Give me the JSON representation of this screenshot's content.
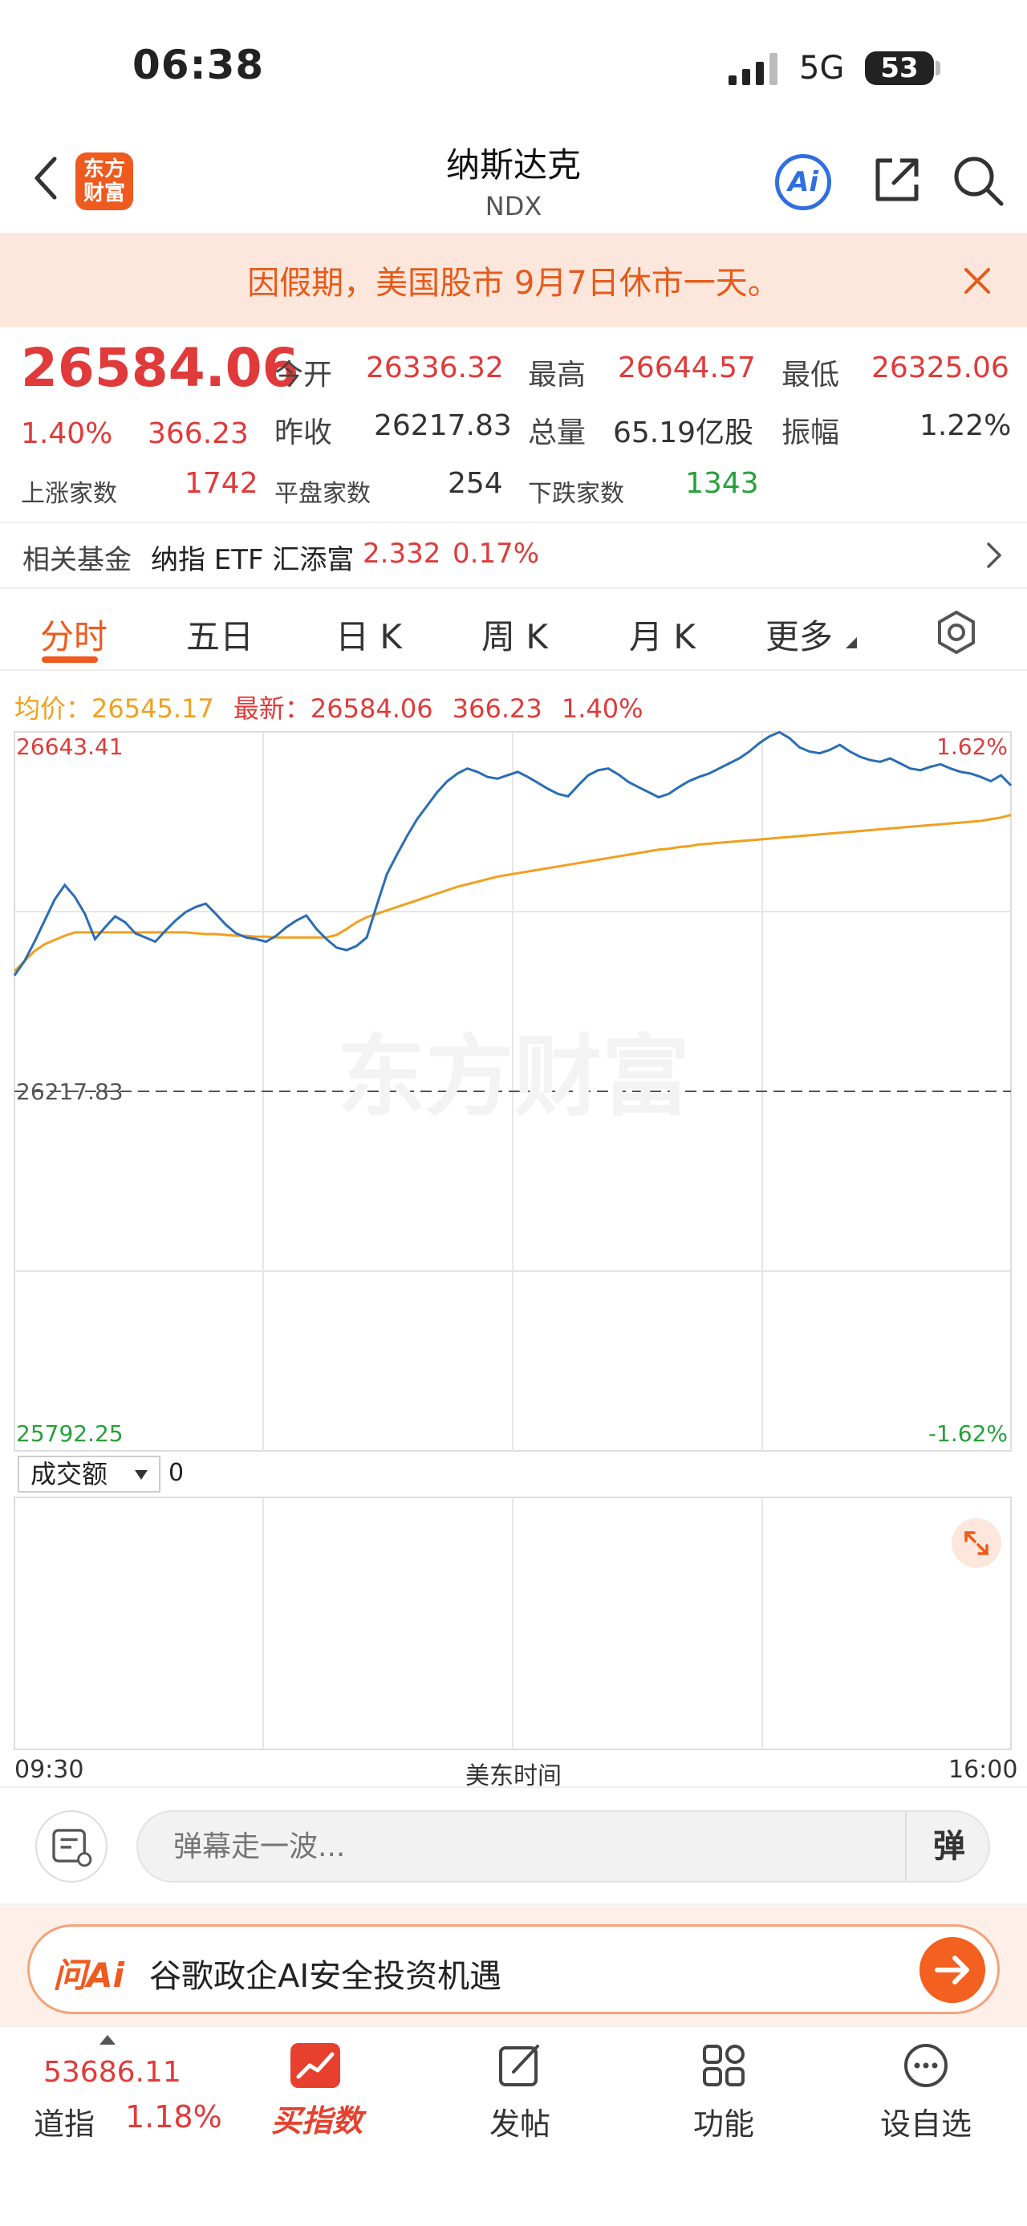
{
  "status_bar": {
    "time": "06:38",
    "network": "5G",
    "battery": "53"
  },
  "header": {
    "title": "纳斯达克",
    "subtitle": "NDX",
    "logo_text_1": "东方",
    "logo_text_2": "财富",
    "ai_label": "Ai"
  },
  "banner": {
    "text": "因假期，美国股市 9月7日休市一天。"
  },
  "quote": {
    "price": "26584.06",
    "change_pct": "1.40%",
    "change": "366.23",
    "open_label": "今开",
    "open": "26336.32",
    "high_label": "最高",
    "high": "26644.57",
    "low_label": "最低",
    "low": "26325.06",
    "prev_close_label": "昨收",
    "prev_close": "26217.83",
    "volume_label": "总量",
    "volume": "65.19亿股",
    "amplitude_label": "振幅",
    "amplitude": "1.22%",
    "up_label": "上涨家数",
    "up_count": "1742",
    "flat_label": "平盘家数",
    "flat_count": "254",
    "down_label": "下跌家数",
    "down_count": "1343"
  },
  "fund": {
    "label": "相关基金",
    "name": "纳指 ETF 汇添富",
    "price": "2.332",
    "pct": "0.17%"
  },
  "tabs": [
    "分时",
    "五日",
    "日 K",
    "周 K",
    "月 K",
    "更多"
  ],
  "chart_header": {
    "avg_label": "均价：",
    "avg_value": "26545.17",
    "latest_label": "最新：",
    "latest_value": "26584.06",
    "latest_change": "366.23",
    "latest_pct": "1.40%"
  },
  "chart_data": {
    "type": "line",
    "y_top_label": "26643.41",
    "y_mid_label": "26217.83",
    "y_bottom_label": "25792.25",
    "pct_top_label": "1.62%",
    "pct_bottom_label": "-1.62%",
    "ylim": [
      25792.25,
      26643.41
    ],
    "baseline": 26217.83,
    "x_start": "09:30",
    "x_end": "16:00",
    "x_label": "美东时间",
    "watermark": "东方财富",
    "series": [
      {
        "color": "#2a6db5",
        "values": [
          26355,
          26372,
          26395,
          26420,
          26445,
          26462,
          26448,
          26428,
          26398,
          26412,
          26425,
          26418,
          26405,
          26400,
          26395,
          26408,
          26420,
          26430,
          26436,
          26440,
          26428,
          26415,
          26405,
          26400,
          26398,
          26395,
          26402,
          26412,
          26420,
          26426,
          26410,
          26398,
          26388,
          26385,
          26390,
          26400,
          26438,
          26475,
          26498,
          26520,
          26540,
          26556,
          26572,
          26585,
          26594,
          26600,
          26596,
          26590,
          26588,
          26592,
          26596,
          26590,
          26583,
          26576,
          26570,
          26567,
          26580,
          26592,
          26598,
          26600,
          26593,
          26584,
          26578,
          26572,
          26566,
          26570,
          26578,
          26585,
          26590,
          26594,
          26600,
          26606,
          26612,
          26620,
          26630,
          26638,
          26643,
          26636,
          26625,
          26620,
          26618,
          26622,
          26628,
          26620,
          26614,
          26610,
          26608,
          26612,
          26606,
          26600,
          26598,
          26602,
          26605,
          26600,
          26596,
          26594,
          26590,
          26585,
          26592,
          26580
        ]
      },
      {
        "color": "#f0a020",
        "values": [
          26360,
          26372,
          26384,
          26392,
          26397,
          26402,
          26406,
          26406,
          26406,
          26406,
          26406,
          26406,
          26406,
          26406,
          26406,
          26406,
          26406,
          26406,
          26405,
          26404,
          26404,
          26403,
          26402,
          26402,
          26401,
          26401,
          26400,
          26400,
          26400,
          26400,
          26400,
          26400,
          26403,
          26410,
          26418,
          26424,
          26428,
          26432,
          26436,
          26440,
          26444,
          26448,
          26452,
          26456,
          26460,
          26463,
          26466,
          26469,
          26472,
          26474,
          26476,
          26478,
          26480,
          26482,
          26484,
          26486,
          26488,
          26490,
          26492,
          26494,
          26496,
          26498,
          26500,
          26502,
          26504,
          26505,
          26507,
          26508,
          26510,
          26511,
          26512,
          26513,
          26514,
          26515,
          26516,
          26517,
          26518,
          26519,
          26520,
          26521,
          26522,
          26523,
          26524,
          26525,
          26526,
          26527,
          26528,
          26529,
          26530,
          26531,
          26532,
          26533,
          26534,
          26535,
          26536,
          26537,
          26538,
          26540,
          26542,
          26545
        ]
      }
    ]
  },
  "volume": {
    "selector": "成交额",
    "value": "0"
  },
  "danmaku": {
    "placeholder": "弹幕走一波...",
    "button": "弹"
  },
  "ask_ai": {
    "logo": "问Ai",
    "text": "谷歌政企AI安全投资机遇"
  },
  "bottom_nav": {
    "dow_value": "53686.11",
    "dow_name": "道指",
    "dow_pct": "1.18%",
    "buy_label": "买指数",
    "post_label": "发帖",
    "func_label": "功能",
    "watch_label": "设自选"
  },
  "colors": {
    "up": "#e03a3a",
    "down": "#27a03a",
    "brand": "#ef5a1e",
    "price_line": "#2a6db5",
    "avg_line": "#f0a020"
  }
}
